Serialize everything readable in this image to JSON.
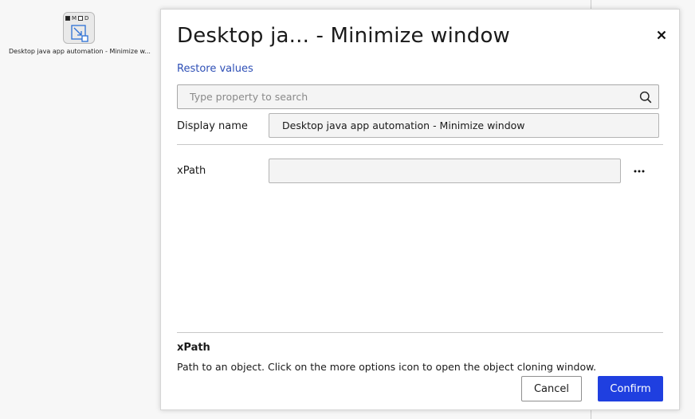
{
  "node": {
    "flags": [
      "M",
      "D"
    ],
    "label": "Desktop java app automation - Minimize w...",
    "icon": "minimize-window-icon"
  },
  "dialog": {
    "title": "Desktop ja... - Minimize window",
    "restore_link": "Restore values",
    "search": {
      "placeholder": "Type property to search",
      "value": ""
    },
    "fields": {
      "display_name": {
        "label": "Display name",
        "value": "Desktop java app automation - Minimize window"
      },
      "xpath": {
        "label": "xPath",
        "value": ""
      }
    },
    "more_options_label": "···",
    "help": {
      "title": "xPath",
      "text": "Path to an object. Click on the more options icon to open the object cloning window."
    },
    "buttons": {
      "cancel": "Cancel",
      "confirm": "Confirm"
    }
  },
  "colors": {
    "accent": "#1f3fe0",
    "link": "#2e4fb6",
    "background": "#f7f7f7"
  }
}
